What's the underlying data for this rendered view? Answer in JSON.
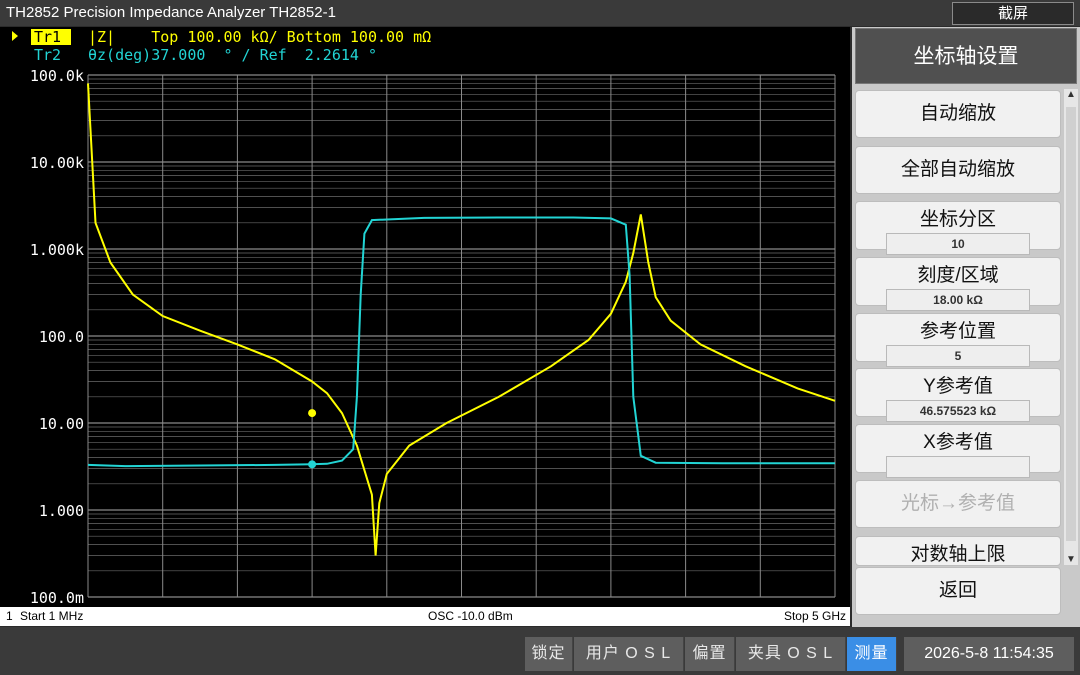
{
  "title": "TH2852 Precision Impedance Analyzer TH2852-1",
  "screenshot_label": "截屏",
  "traces": {
    "tr1_label": "Tr1",
    "tr1_text": "|Z|    Top 100.00 kΩ/ Bottom 100.00 mΩ",
    "tr2_label": "Tr2",
    "tr2_text": "θz(deg)37.000  ° / Ref  2.2614 °"
  },
  "y_axis_labels": [
    "100.0k",
    "10.00k",
    "1.000k",
    "100.0",
    "10.00",
    "1.000",
    "100.0m"
  ],
  "status": {
    "channel": "1",
    "start": "Start  1 MHz",
    "osc": "OSC -10.0 dBm",
    "stop": "Stop  5 GHz"
  },
  "panel": {
    "header": "坐标轴设置",
    "buttons": [
      {
        "label": "自动缩放"
      },
      {
        "label": "全部自动缩放"
      },
      {
        "label": "坐标分区",
        "value": "10"
      },
      {
        "label": "刻度/区域",
        "value": "18.00 kΩ"
      },
      {
        "label": "参考位置",
        "value": "5"
      },
      {
        "label": "Y参考值",
        "value": "46.575523 kΩ"
      },
      {
        "label": "X参考值",
        "value": ""
      },
      {
        "label": "光标→参考值"
      },
      {
        "label": "对数轴上限"
      }
    ],
    "return_label": "返回"
  },
  "footer": {
    "buttons": [
      "锁定",
      "用户  O S L",
      "偏置",
      "夹具  O S L",
      "测量"
    ],
    "clock": "2026-5-8 11:54:35"
  },
  "colors": {
    "trace1": "#ffff00",
    "trace2": "#22d4d4",
    "grid": "#6a6a6a",
    "active": "#3a8ee6"
  },
  "chart_data": {
    "type": "line",
    "y_scale": "log",
    "ylim": [
      0.1,
      100000
    ],
    "xlim": [
      0,
      1
    ],
    "series": [
      {
        "name": "Tr1",
        "x": [
          0.0,
          0.01,
          0.03,
          0.06,
          0.1,
          0.15,
          0.2,
          0.25,
          0.3,
          0.32,
          0.34,
          0.36,
          0.38,
          0.385,
          0.39,
          0.4,
          0.43,
          0.48,
          0.55,
          0.62,
          0.67,
          0.7,
          0.72,
          0.73,
          0.74,
          0.75,
          0.76,
          0.78,
          0.82,
          0.88,
          0.95,
          1.0
        ],
        "y": [
          80000,
          2000,
          700,
          300,
          170,
          115,
          80,
          54,
          30,
          22,
          13,
          5.5,
          1.5,
          0.3,
          1.2,
          2.6,
          5.5,
          10,
          20,
          45,
          90,
          180,
          420,
          900,
          2500,
          700,
          280,
          150,
          80,
          45,
          25,
          18
        ]
      },
      {
        "name": "Tr2",
        "x": [
          0.0,
          0.05,
          0.15,
          0.25,
          0.3,
          0.32,
          0.34,
          0.355,
          0.36,
          0.365,
          0.37,
          0.38,
          0.45,
          0.55,
          0.65,
          0.7,
          0.72,
          0.725,
          0.73,
          0.74,
          0.76,
          0.85,
          1.0
        ],
        "y": [
          3.3,
          3.2,
          3.25,
          3.3,
          3.35,
          3.4,
          3.7,
          5,
          20,
          300,
          1500,
          2150,
          2280,
          2300,
          2300,
          2250,
          1900,
          500,
          20,
          4.2,
          3.5,
          3.45,
          3.45
        ]
      }
    ],
    "markers": [
      {
        "series": "Tr1",
        "x": 0.3,
        "y": 13
      },
      {
        "series": "Tr2",
        "x": 0.3,
        "y": 3.35
      }
    ]
  }
}
